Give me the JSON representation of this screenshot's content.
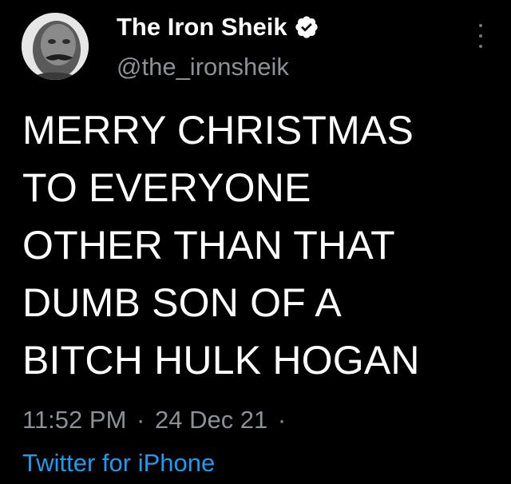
{
  "tweet": {
    "display_name": "The Iron Sheik",
    "handle": "@the_ironsheik",
    "verified_icon": "verified-badge-icon",
    "more_icon": "more-options-icon",
    "text_lines": [
      "MERRY CHRISTMAS",
      "TO EVERYONE",
      "OTHER THAN THAT",
      "DUMB SON OF A",
      "BITCH HULK HOGAN"
    ],
    "time": "11:52 PM",
    "separator": "·",
    "date": "24 Dec 21",
    "trailing_separator": "·",
    "source": "Twitter for iPhone"
  },
  "colors": {
    "background": "#000000",
    "text": "#ffffff",
    "secondary_text": "#8b9197",
    "link": "#1d9bf0"
  }
}
